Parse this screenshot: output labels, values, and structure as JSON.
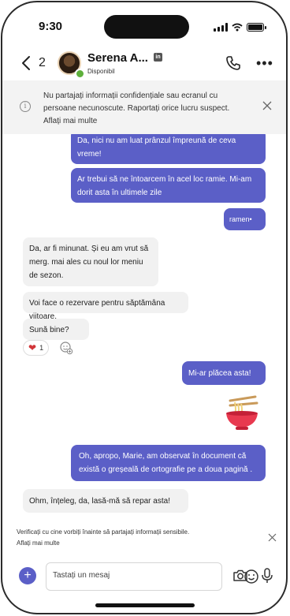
{
  "status_bar": {
    "time": "9:30"
  },
  "header": {
    "back_count": "2",
    "contact_name": "Serena A...",
    "contact_status": "Disponibil",
    "linkedin_badge": "in"
  },
  "banner": {
    "text": "Nu partajați informații confidențiale sau ecranul cu persoane necunoscute. Raportați orice lucru suspect. Aflați mai multe"
  },
  "messages": [
    {
      "from": "me",
      "text": "Da, nici nu am luat prânzul împreună de ceva vreme!"
    },
    {
      "from": "me",
      "text": "Ar trebui să ne întoarcem în acel loc ramie. Mi-am dorit asta în ultimele zile"
    },
    {
      "from": "me",
      "text": "ramen•"
    },
    {
      "from": "them",
      "text": "Da, ar fi minunat. Și eu am vrut să merg. mai ales cu noul lor meniu de sezon."
    },
    {
      "from": "them",
      "text": "Voi face o rezervare pentru săptămâna viitoare."
    },
    {
      "from": "them",
      "text": "Sună bine?"
    },
    {
      "from": "me",
      "text": "Mi-ar plăcea asta!"
    },
    {
      "from": "me",
      "text": "Oh, apropo, Marie, am observat în document că există o greșeală de ortografie pe a doua pagină ."
    },
    {
      "from": "them",
      "text": "Ohm, înțeleg, da, lasă-mă să repar asta!"
    }
  ],
  "reaction": {
    "icon": "heart-icon",
    "count": "1"
  },
  "sticker": {
    "icon": "ramen-bowl-icon"
  },
  "footer_note": {
    "line1": "Verificați cu cine vorbiți înainte să partajați informații sensibile.",
    "line2": "Aflați mai multe"
  },
  "compose": {
    "placeholder": "Tastați un mesaj"
  },
  "colors": {
    "accent": "#5b5fc7",
    "incoming": "#f1f1f1",
    "banner": "#f3f3f3"
  }
}
